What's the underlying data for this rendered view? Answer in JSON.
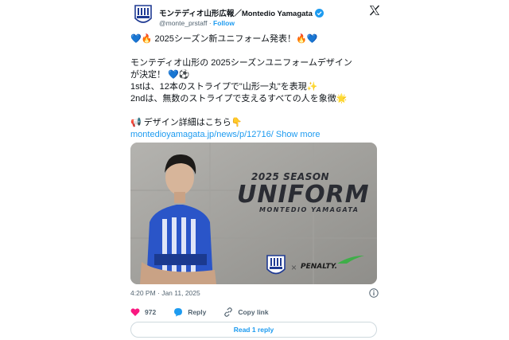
{
  "author": {
    "display_name": "モンテディオ山形広報／Montedio Yamagata",
    "handle": "@monte_prstaff",
    "separator": " · ",
    "follow_label": "Follow"
  },
  "tweet": {
    "lines": [
      "💙🔥 2025シーズン新ユニフォーム発表！🔥💙",
      "",
      "モンテディオ山形の 2025シーズンユニフォームデザイン",
      "が決定！ 💙⚽",
      "1stは、12本のストライプで\"山形一丸\"を表現✨",
      "2ndは、無数のストライプで支えるすべての人を象徴🌟",
      "",
      "📢 デザイン詳細はこちら👇"
    ],
    "link_text": "montedioyamagata.jp/news/p/12716/",
    "show_more": "Show more"
  },
  "media": {
    "season_text": "2025 SEASON",
    "uniform_text": "UNIFORM",
    "team_text": "MONTEDIO YAMAGATA",
    "cross": "×",
    "sponsor_text": "PENALTY."
  },
  "meta": {
    "timestamp": "4:20 PM · Jan 11, 2025"
  },
  "actions": {
    "like_count": "972",
    "reply_label": "Reply",
    "copy_link_label": "Copy link"
  },
  "read_replies_label": "Read 1 reply",
  "colors": {
    "accent": "#1d9bf0",
    "like": "#f91880",
    "text": "#0f1419",
    "muted": "#536471",
    "team_blue": "#1f3a93"
  }
}
